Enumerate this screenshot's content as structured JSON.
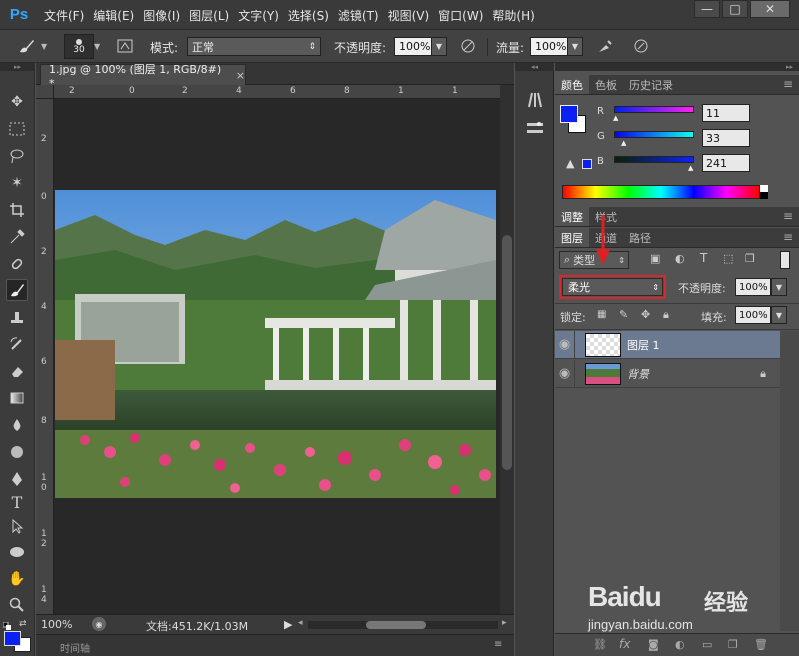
{
  "app": {
    "logo": "Ps"
  },
  "menu": [
    "文件(F)",
    "编辑(E)",
    "图像(I)",
    "图层(L)",
    "文字(Y)",
    "选择(S)",
    "滤镜(T)",
    "视图(V)",
    "窗口(W)",
    "帮助(H)"
  ],
  "window_controls": {
    "minimize": "—",
    "restore": "□",
    "close": "✕"
  },
  "options": {
    "brush_size": "30",
    "mode_label": "模式:",
    "mode_value": "正常",
    "opacity_label": "不透明度:",
    "opacity_value": "100%",
    "flow_label": "流量:",
    "flow_value": "100%"
  },
  "document": {
    "tab_title": "1.jpg @ 100% (图层 1, RGB/8#) *",
    "tab_close": "×",
    "zoom": "100%",
    "doc_info": "文档:451.2K/1.03M",
    "timeline_label": "时间轴"
  },
  "ruler": {
    "h": [
      "2",
      "0",
      "2",
      "4",
      "6",
      "8",
      "1",
      "1",
      "1",
      "1"
    ],
    "v": [
      "2",
      "0",
      "2",
      "4",
      "6",
      "8",
      "1\n0",
      "1\n2",
      "1\n4"
    ]
  },
  "colors": {
    "fg": "#0b21f1",
    "r_label": "R",
    "g_label": "G",
    "b_label": "B",
    "r_value": "11",
    "g_value": "33",
    "b_value": "241"
  },
  "color_panel": {
    "tabs": [
      "颜色",
      "色板",
      "历史记录"
    ]
  },
  "adjust_panel": {
    "tabs": [
      "调整",
      "样式"
    ]
  },
  "layers_panel": {
    "tabs": [
      "图层",
      "通道",
      "路径"
    ],
    "filter_label": "类型",
    "blend_mode": "柔光",
    "opacity_label": "不透明度:",
    "opacity_value": "100%",
    "lock_label": "锁定:",
    "fill_label": "填充:",
    "fill_value": "100%",
    "layers": [
      {
        "name": "图层 1",
        "selected": true
      },
      {
        "name": "背景",
        "selected": false,
        "locked": true
      }
    ]
  },
  "watermark": {
    "brand": "Baidu",
    "brand_cn": "经验",
    "url": "jingyan.baidu.com"
  }
}
